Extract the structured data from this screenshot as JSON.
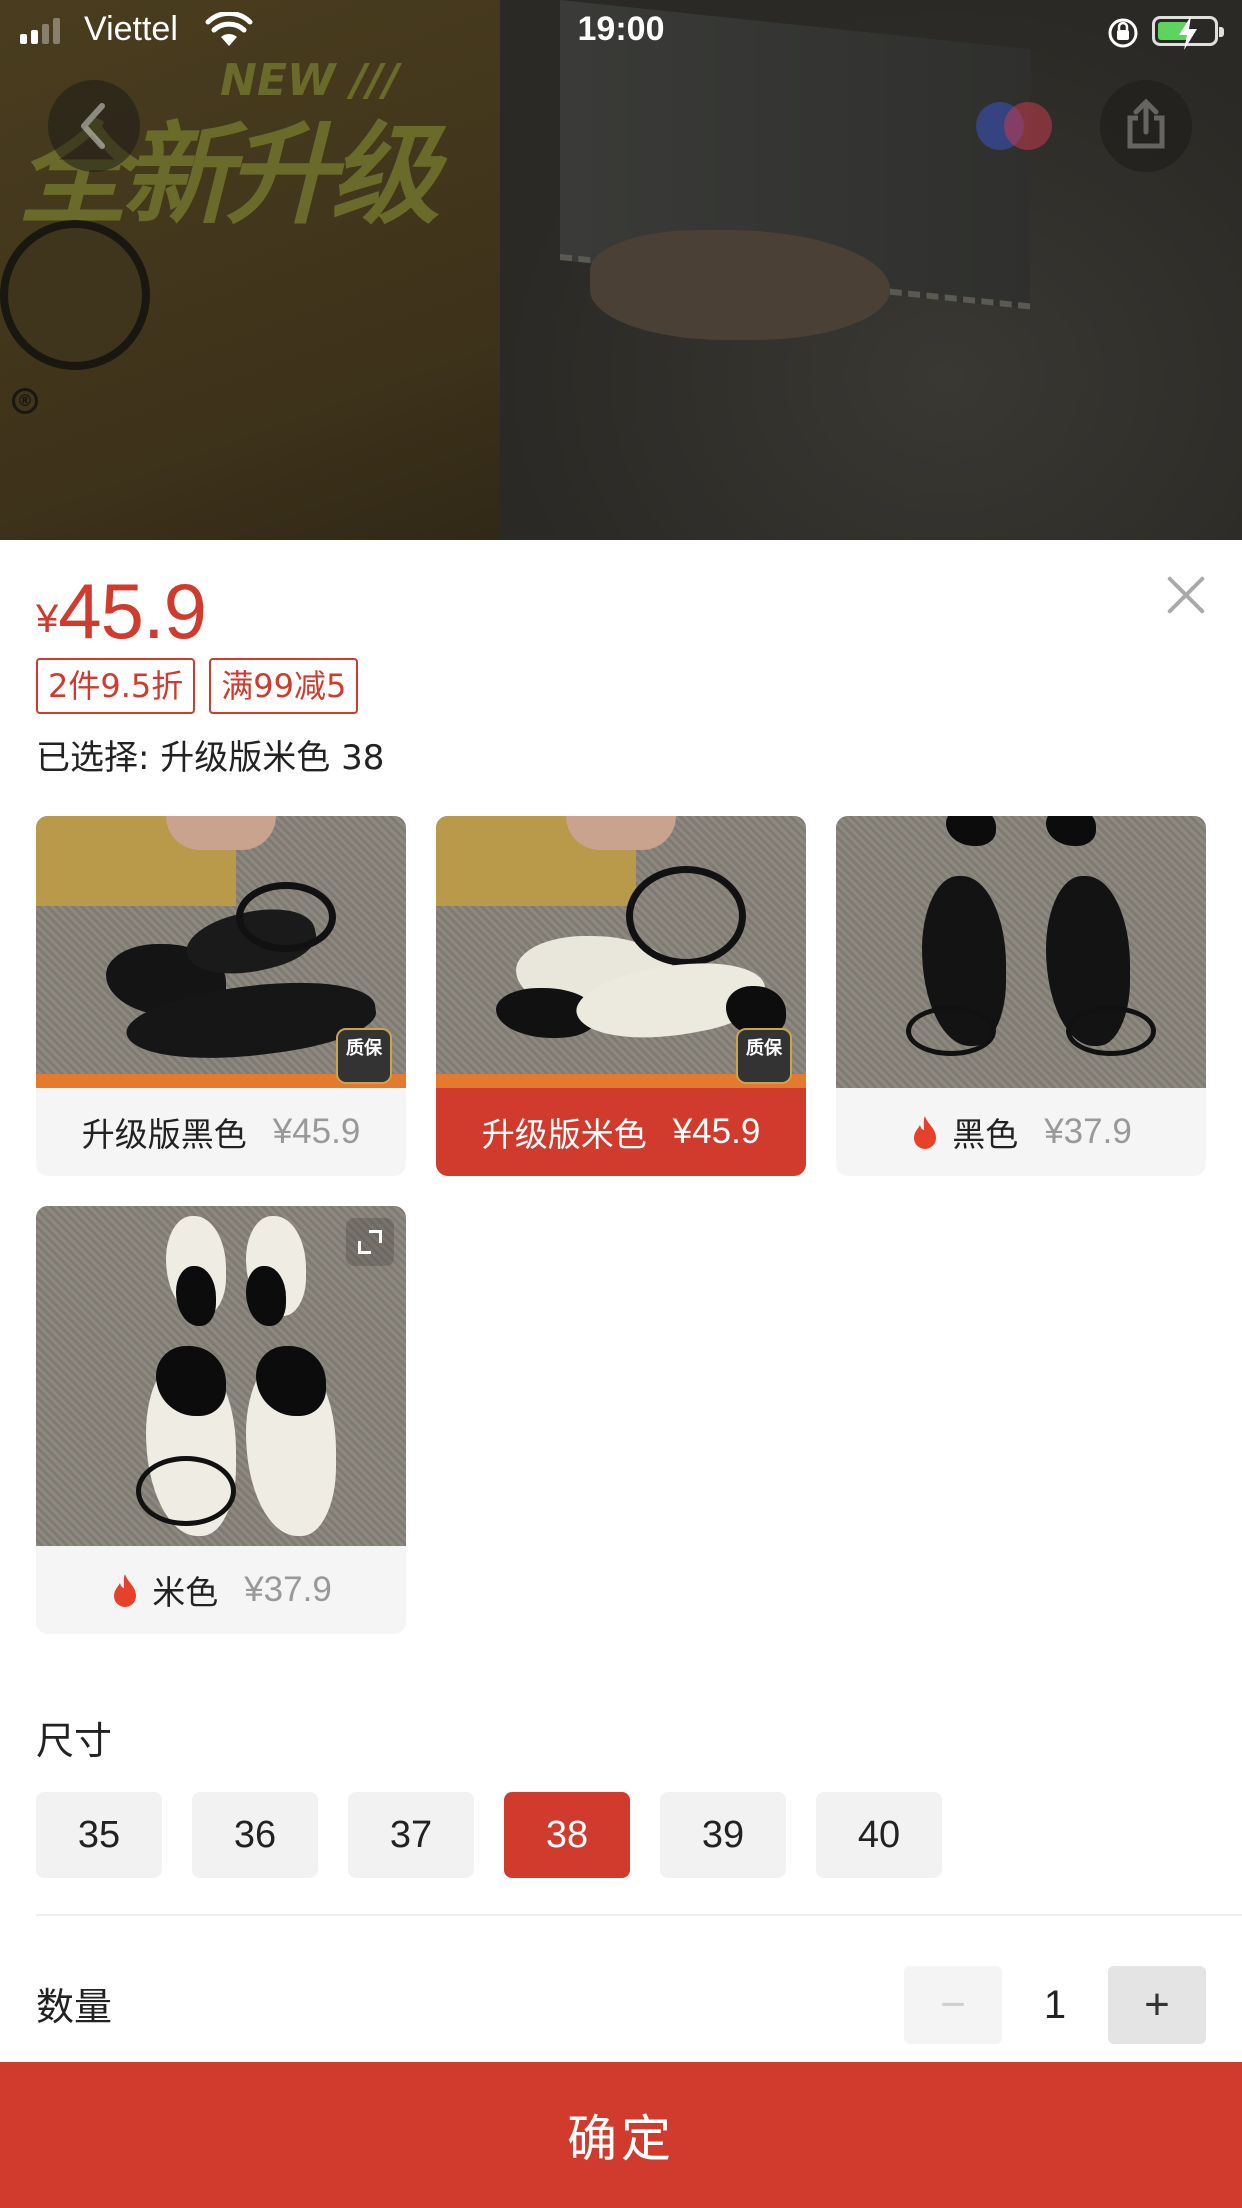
{
  "status_bar": {
    "carrier": "Viettel",
    "time": "19:00",
    "battery_charging": true
  },
  "backdrop": {
    "banner_text": "全新升级",
    "banner_tag": "NEW ///",
    "reg_mark": "®"
  },
  "nav": {
    "back_icon": "chevron-left-icon",
    "share_icon": "share-icon"
  },
  "product": {
    "currency": "¥",
    "price": "45.9",
    "promo_tags": [
      "2件9.5折",
      "满99减5"
    ],
    "selected_text": "已选择: 升级版米色 38"
  },
  "variants": [
    {
      "name": "升级版黑色",
      "price": "¥45.9",
      "hot": false,
      "active": false,
      "badge": "质保"
    },
    {
      "name": "升级版米色",
      "price": "¥45.9",
      "hot": false,
      "active": true,
      "badge": "质保"
    },
    {
      "name": "黑色",
      "price": "¥37.9",
      "hot": true,
      "active": false
    },
    {
      "name": "米色",
      "price": "¥37.9",
      "hot": true,
      "active": false
    }
  ],
  "size_section": {
    "title": "尺寸",
    "options": [
      "35",
      "36",
      "37",
      "38",
      "39",
      "40"
    ],
    "selected": "38"
  },
  "quantity": {
    "label": "数量",
    "value": "1",
    "minus": "−",
    "plus": "+"
  },
  "confirm_label": "确定",
  "colors": {
    "accent": "#d13b2e",
    "muted_price": "#999999"
  }
}
